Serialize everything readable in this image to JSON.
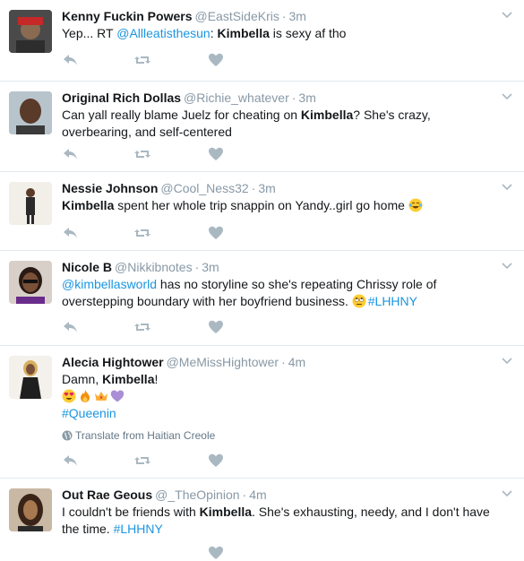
{
  "colors": {
    "link": "#1b95e0",
    "meta": "#8899a6",
    "icon": "#aab8c2",
    "divider": "#e1e8ed"
  },
  "tweets": [
    {
      "name": "Kenny Fuckin Powers",
      "handle": "@EastSideKris",
      "time": "3m",
      "text": {
        "t1": "Yep... RT ",
        "mention": "@Allleatisthesun",
        "t2": ": ",
        "b": "Kimbella",
        "t3": " is sexy af tho"
      }
    },
    {
      "name": "Original Rich Dollas",
      "handle": "@Richie_whatever",
      "time": "3m",
      "text": {
        "t1": "Can yall really blame Juelz for cheating on ",
        "b": "Kimbella",
        "t2": "? She's crazy, overbearing, and self-centered"
      }
    },
    {
      "name": "Nessie Johnson",
      "handle": "@Cool_Ness32",
      "time": "3m",
      "text": {
        "b": "Kimbella",
        "t1": " spent her whole trip snappin on Yandy..girl go home "
      },
      "emoji": "face-with-tears-of-joy"
    },
    {
      "name": "Nicole B",
      "handle": "@Nikkibnotes",
      "time": "3m",
      "text": {
        "mention": "@kimbellasworld",
        "t1": " has no storyline so she's repeating Chrissy role of overstepping boundary with her boyfriend business. ",
        "hashtag": "#LHHNY"
      },
      "emoji": "eye-roll-face"
    },
    {
      "name": "Alecia Hightower",
      "handle": "@MeMissHightower",
      "time": "4m",
      "text": {
        "t1": "Damn, ",
        "b": "Kimbella",
        "t2": "!",
        "hashtag": "#Queenin"
      },
      "emojis": [
        "heart-eyes-face",
        "fire",
        "crown",
        "purple-heart"
      ],
      "translate": "Translate from Haitian Creole"
    },
    {
      "name": "Out Rae Geous",
      "handle": "@_TheOpinion",
      "time": "4m",
      "text": {
        "t1": "I couldn't be friends with ",
        "b": "Kimbella",
        "t2": ". She's exhausting, needy, and I don't have the time. ",
        "hashtag": "#LHHNY"
      }
    }
  ],
  "icons": {
    "reply": "reply-icon",
    "retweet": "retweet-icon",
    "like": "heart-icon",
    "caret": "chevron-down-icon",
    "globe": "globe-icon"
  }
}
